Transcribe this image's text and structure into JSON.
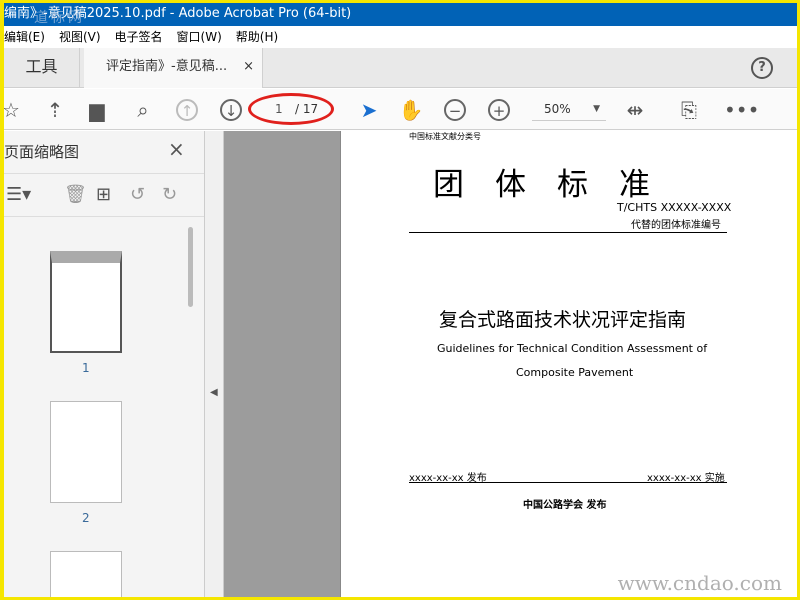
{
  "window": {
    "title": "编南》-意见稿2025.10.pdf - Adobe Acrobat Pro (64-bit)",
    "watermark": "道标网"
  },
  "menu": [
    "编辑(E)",
    "视图(V)",
    "电子签名",
    "窗口(W)",
    "帮助(H)"
  ],
  "tabs": {
    "tools": "工具",
    "doc": "评定指南》-意见稿...",
    "close": "×",
    "help": "?"
  },
  "toolbar": {
    "current_page": "1",
    "total_pages": "/ 17",
    "zoom": "50%"
  },
  "left_panel": {
    "title": "页面缩略图",
    "close": "×",
    "thumbs": [
      "1",
      "2"
    ]
  },
  "document": {
    "classification": "中国标准文献分类号",
    "heading": "团　体　标　准",
    "code": "T/CHTS  XXXXX-XXXX",
    "replaces": "代替的团体标准编号",
    "title_cn": "复合式路面技术状况评定指南",
    "title_en_1": "Guidelines for Technical Condition Assessment of",
    "title_en_2": "Composite Pavement",
    "release": "xxxx-xx-xx 发布",
    "implement": "xxxx-xx-xx 实施",
    "publisher": "中国公路学会  发布"
  },
  "site_watermark": "www.cndao.com"
}
